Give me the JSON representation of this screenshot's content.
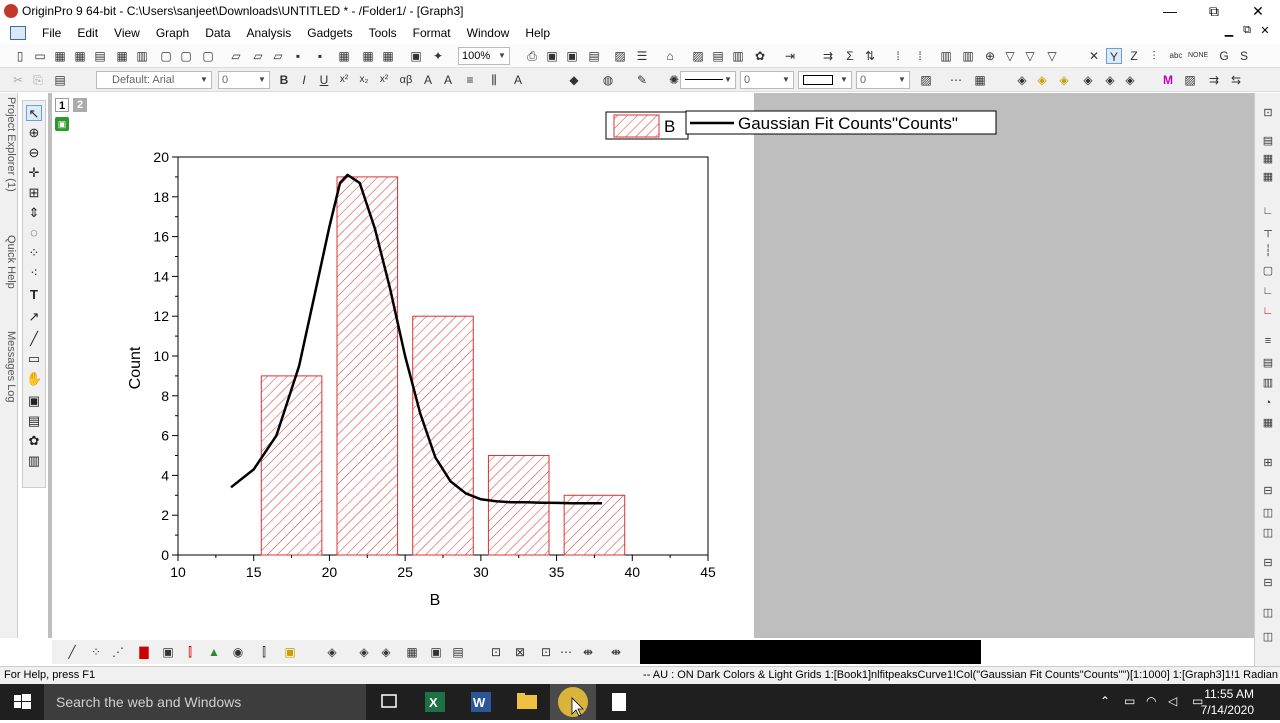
{
  "window": {
    "title": "OriginPro 9 64-bit - C:\\Users\\sanjeet\\Downloads\\UNTITLED * - /Folder1/ - [Graph3]",
    "minimize_icon": "—",
    "restore_icon": "⧉",
    "close_icon": "✕"
  },
  "menu": {
    "items": [
      "File",
      "Edit",
      "View",
      "Graph",
      "Data",
      "Analysis",
      "Gadgets",
      "Tools",
      "Format",
      "Window",
      "Help"
    ]
  },
  "toolbar1": {
    "zoom": "100%"
  },
  "toolbar2": {
    "font": "Default: Arial",
    "font_size": "0",
    "bold": "B",
    "italic": "I",
    "underline": "U",
    "line_width": "0",
    "border_size": "0"
  },
  "left_panel": {
    "tabs": [
      "Project Explorer (1)",
      "Quick Help",
      "Messages Log"
    ]
  },
  "graph": {
    "layer_buttons": [
      "1",
      "2"
    ],
    "legend": {
      "bar_entry": "B",
      "line_entry": "Gaussian Fit Counts\"Counts\""
    }
  },
  "chart_data": {
    "type": "bar",
    "xlabel": "B",
    "ylabel": "Count",
    "xlim": [
      10,
      45
    ],
    "ylim": [
      0,
      20
    ],
    "x_ticks": [
      10,
      15,
      20,
      25,
      30,
      35,
      40,
      45
    ],
    "y_ticks": [
      0,
      2,
      4,
      6,
      8,
      10,
      12,
      14,
      16,
      18,
      20
    ],
    "bar_fill": "#e03030",
    "bars": [
      {
        "x_from": 15.5,
        "x_to": 19.5,
        "value": 9
      },
      {
        "x_from": 20.5,
        "x_to": 24.5,
        "value": 19
      },
      {
        "x_from": 25.5,
        "x_to": 29.5,
        "value": 12
      },
      {
        "x_from": 30.5,
        "x_to": 34.5,
        "value": 5
      },
      {
        "x_from": 35.5,
        "x_to": 39.5,
        "value": 3
      }
    ],
    "series": [
      {
        "name": "Gaussian Fit Counts\"Counts\"",
        "type": "line",
        "color": "#000000",
        "x": [
          13.5,
          15,
          16.5,
          18,
          19,
          20,
          20.7,
          21.2,
          22,
          23,
          24,
          25,
          26,
          27,
          28,
          29,
          30,
          31,
          32,
          33,
          34,
          35,
          36,
          37,
          38
        ],
        "y": [
          3.4,
          4.3,
          6.0,
          9.5,
          13.0,
          16.5,
          18.7,
          19.1,
          18.7,
          16.4,
          13.4,
          10.0,
          7.1,
          4.9,
          3.7,
          3.1,
          2.8,
          2.7,
          2.65,
          2.65,
          2.63,
          2.62,
          2.6,
          2.6,
          2.6
        ]
      }
    ]
  },
  "status": {
    "left": "For Help, press F1",
    "right": "-- AU : ON  Dark Colors & Light Grids  1:[Book1]nlfitpeaksCurve1!Col(\"Gaussian Fit Counts\"Counts\"\")[1:1000]  1:[Graph3]1!1  Radian"
  },
  "taskbar": {
    "search_placeholder": "Search the web and Windows",
    "time": "11:55 AM",
    "date": "7/14/2020"
  }
}
